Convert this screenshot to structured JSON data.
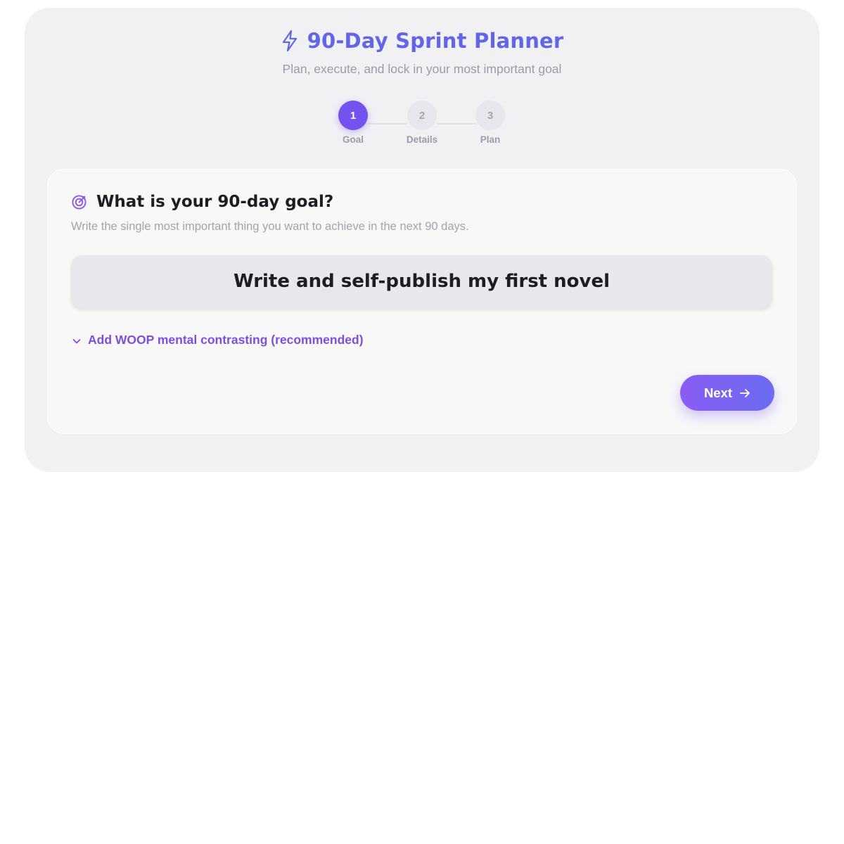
{
  "header": {
    "title": "90-Day Sprint Planner",
    "subtitle": "Plan, execute, and lock in your most important goal",
    "title_icon": "bolt-icon"
  },
  "stepper": {
    "current_step": 1,
    "steps": [
      {
        "number": "1",
        "label": "Goal",
        "state": "active"
      },
      {
        "number": "2",
        "label": "Details",
        "state": "inactive"
      },
      {
        "number": "3",
        "label": "Plan",
        "state": "inactive"
      }
    ]
  },
  "goal_card": {
    "icon": "target-icon",
    "question": "What is your 90-day goal?",
    "hint": "Write the single most important thing you want to achieve in the next 90 days.",
    "goal_value": "Write and self-publish my first novel",
    "woop_toggle_label": "Add WOOP mental contrasting (recommended)",
    "woop_icon": "chevron-down-icon",
    "next_label": "Next",
    "next_icon": "arrow-right-icon"
  },
  "colors": {
    "accent": "#7452ef",
    "title": "#6066e6",
    "link": "#7c4fe0",
    "text_dark": "#1d1d24",
    "text_muted": "#9c9ca8"
  }
}
